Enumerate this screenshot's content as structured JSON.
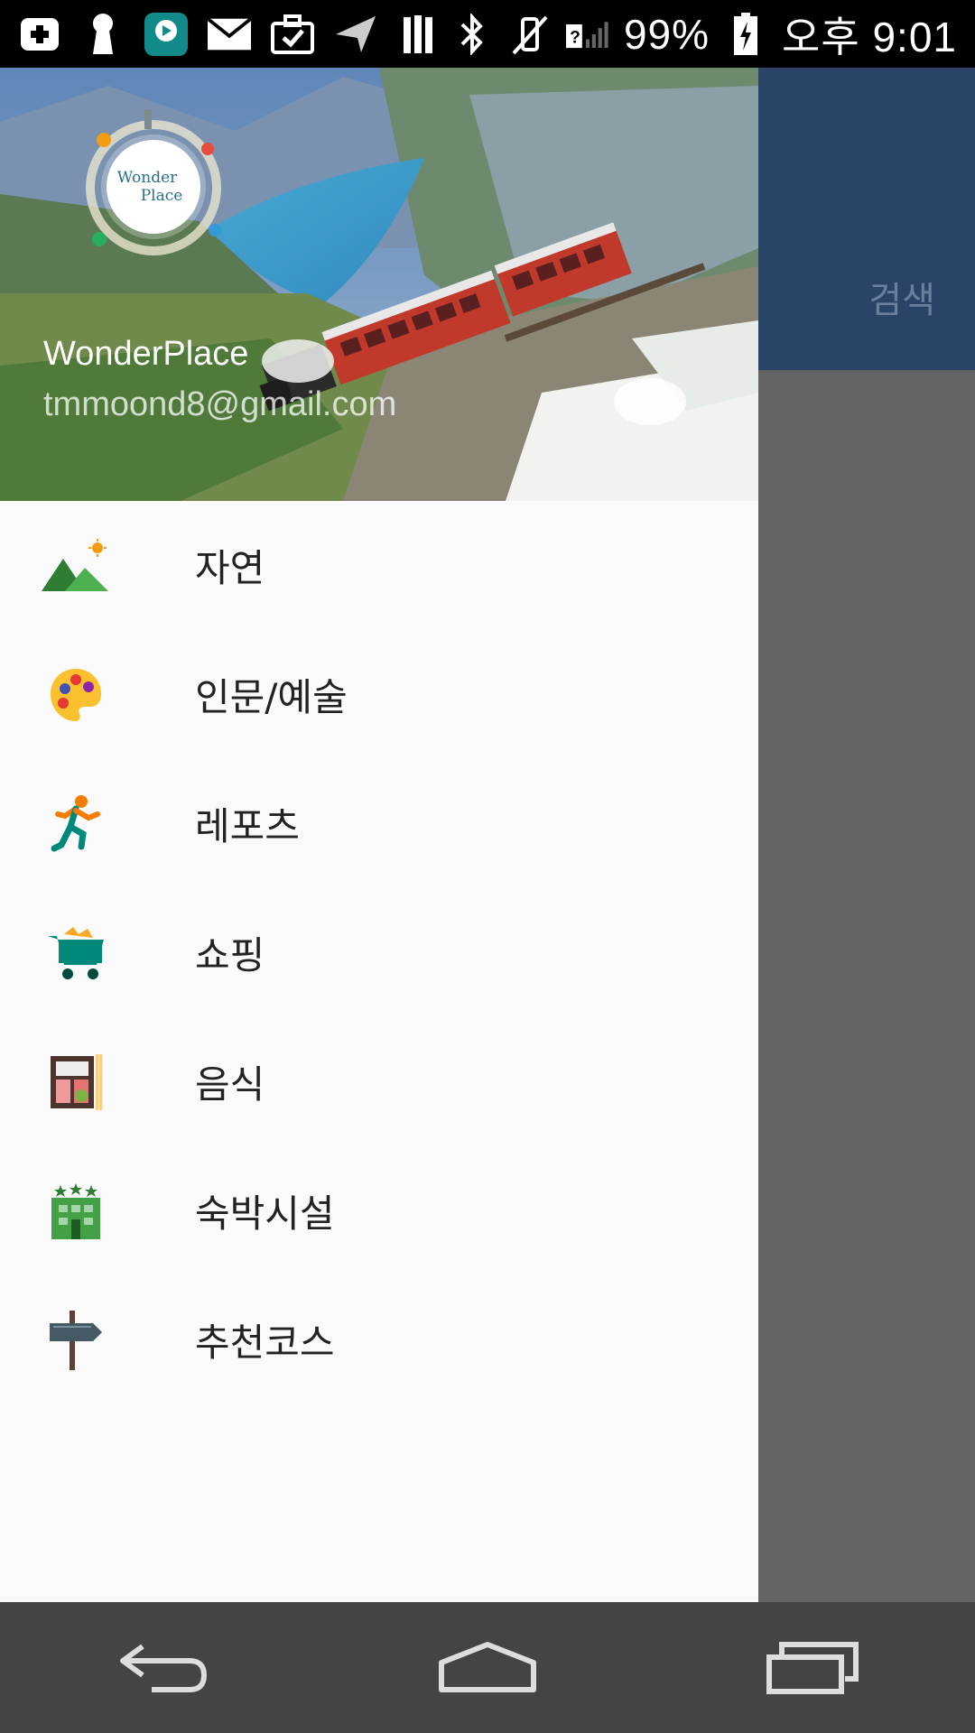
{
  "status_bar": {
    "battery": "99%",
    "time": "오후 9:01",
    "left_icons": [
      "add-box-icon",
      "keyhole-icon",
      "app-player-icon",
      "mail-icon",
      "briefcase-check-icon",
      "navigation-arrow-icon",
      "library-icon"
    ],
    "right_icons": [
      "bluetooth-icon",
      "vibrate-off-icon",
      "no-sim-signal-icon",
      "battery-charging-icon"
    ]
  },
  "background_app": {
    "search_label": "검색",
    "toolbar_color": "#2a4468"
  },
  "drawer": {
    "header": {
      "logo_line1": "Wonder",
      "logo_line2": "Place",
      "user_name": "WonderPlace",
      "user_email": "tmmoond8@gmail.com"
    },
    "items": [
      {
        "label": "자연",
        "icon": "nature-mountain-icon"
      },
      {
        "label": "인문/예술",
        "icon": "palette-icon"
      },
      {
        "label": "레포츠",
        "icon": "runner-icon"
      },
      {
        "label": "쇼핑",
        "icon": "shopping-cart-icon"
      },
      {
        "label": "음식",
        "icon": "food-bento-icon"
      },
      {
        "label": "숙박시설",
        "icon": "hotel-icon"
      },
      {
        "label": "추천코스",
        "icon": "signpost-icon"
      }
    ]
  },
  "nav_bar": {
    "buttons": [
      "back-icon",
      "home-icon",
      "recents-icon"
    ]
  }
}
